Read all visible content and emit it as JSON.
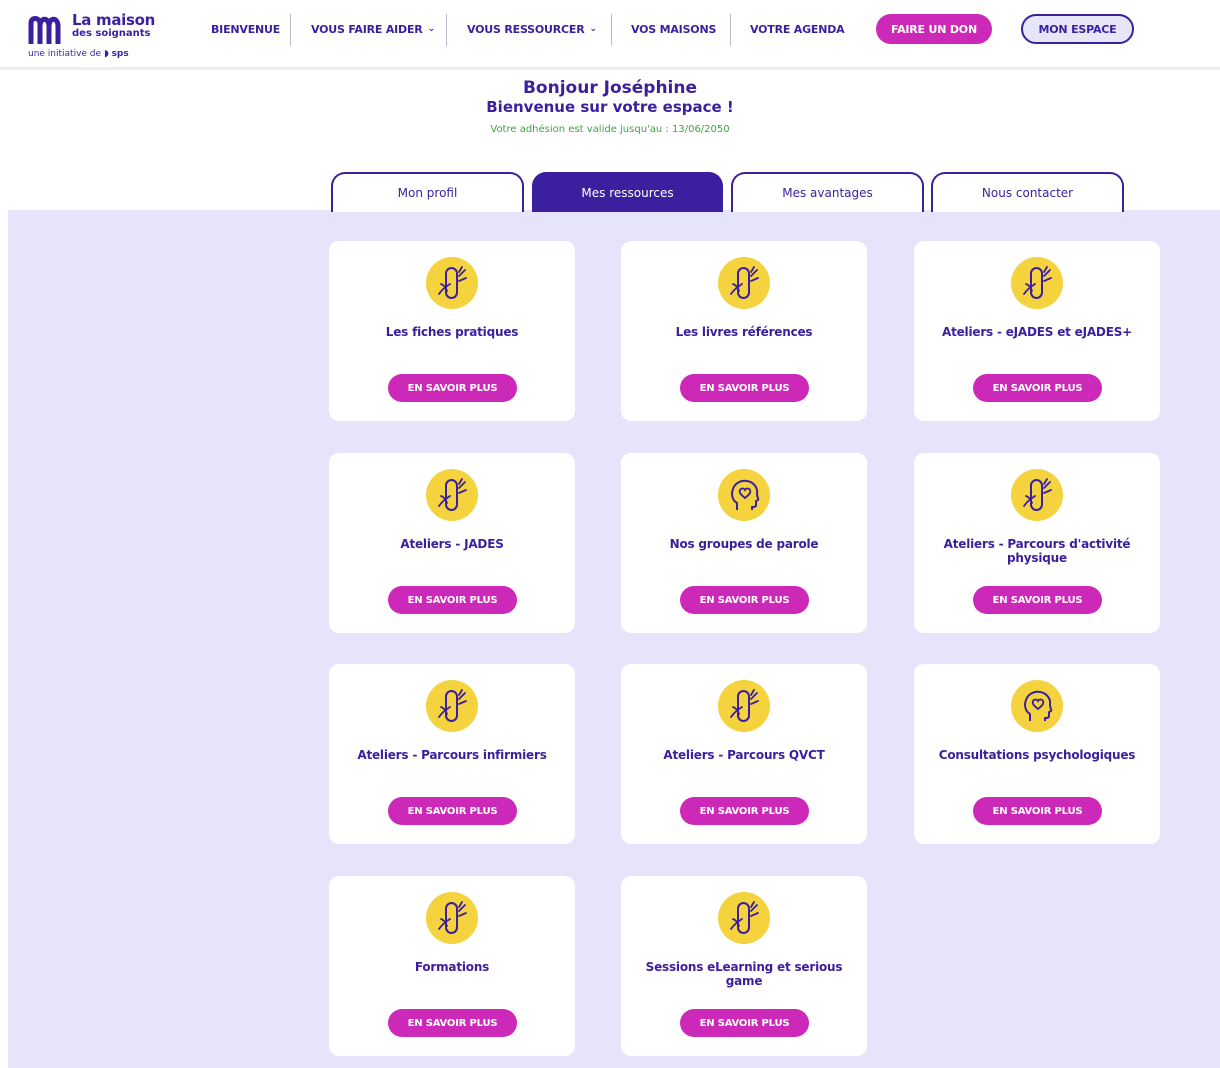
{
  "brand": {
    "title": "La maison",
    "subtitle": "des soignants",
    "tagline_prefix": "une initiative de",
    "tagline_brand": "sps"
  },
  "nav": {
    "bienvenue": "BIENVENUE",
    "faire_aider": "VOUS FAIRE AIDER",
    "ressourcer": "VOUS RESSOURCER",
    "maisons": "VOS MAISONS",
    "agenda": "VOTRE AGENDA",
    "don": "FAIRE UN DON",
    "espace": "MON ESPACE"
  },
  "greeting": {
    "hello": "Bonjour Joséphine",
    "welcome": "Bienvenue sur votre espace !",
    "validity": "Votre adhésion est valide jusqu'au : 13/06/2050"
  },
  "tabs": [
    {
      "label": "Mon profil"
    },
    {
      "label": "Mes ressources"
    },
    {
      "label": "Mes avantages"
    },
    {
      "label": "Nous contacter"
    }
  ],
  "colors": {
    "primary": "#3b1f9e",
    "accent": "#cc29b8",
    "icon_bg": "#f5d33f",
    "validity_green": "#42a24a",
    "content_bg": "#e5e4fb"
  },
  "cta_label": "EN SAVOIR PLUS",
  "cards": [
    {
      "title": "Les fiches pratiques",
      "icon": "leaf-icon"
    },
    {
      "title": "Les livres références",
      "icon": "leaf-icon"
    },
    {
      "title": "Ateliers - eJADES et eJADES+",
      "icon": "leaf-icon"
    },
    {
      "title": "Ateliers - JADES",
      "icon": "leaf-icon"
    },
    {
      "title": "Nos groupes de parole",
      "icon": "head-heart-icon"
    },
    {
      "title": "Ateliers - Parcours d'activité physique",
      "icon": "leaf-icon"
    },
    {
      "title": "Ateliers - Parcours infirmiers",
      "icon": "leaf-icon"
    },
    {
      "title": "Ateliers - Parcours QVCT",
      "icon": "leaf-icon"
    },
    {
      "title": "Consultations psychologiques",
      "icon": "head-heart-icon"
    },
    {
      "title": "Formations",
      "icon": "leaf-icon"
    },
    {
      "title": "Sessions eLearning et serious game",
      "icon": "leaf-icon"
    }
  ]
}
